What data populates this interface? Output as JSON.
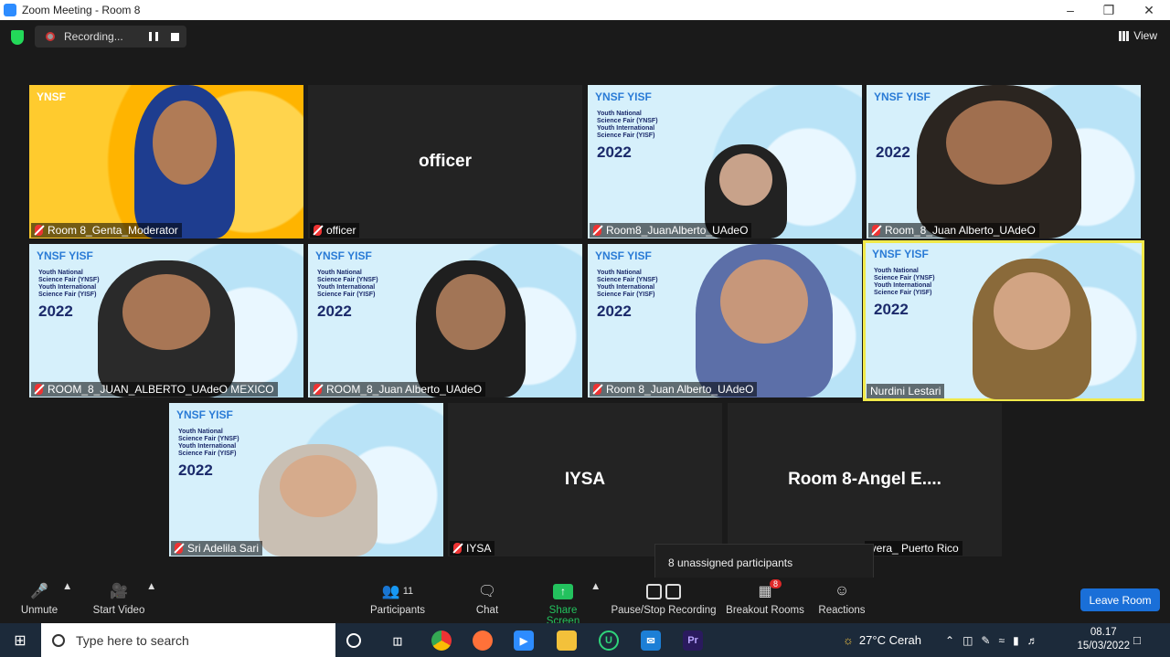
{
  "window": {
    "title": "Zoom Meeting - Room 8"
  },
  "recording": {
    "label": "Recording..."
  },
  "view_label": "View",
  "tiles": [
    {
      "name": "Room 8_Genta_Moderator",
      "big": ""
    },
    {
      "name": "officer",
      "big": "officer"
    },
    {
      "name": "Room8_JuanAlberto_UAdeO",
      "big": ""
    },
    {
      "name": "Room_8_Juan Alberto_UAdeO",
      "big": ""
    },
    {
      "name": "ROOM_8_JUAN_ALBERTO_UAdeO MEXICO",
      "big": ""
    },
    {
      "name": "ROOM_8_Juan Alberto_UAdeO",
      "big": ""
    },
    {
      "name": "Room 8_Juan Alberto_UAdeO",
      "big": ""
    },
    {
      "name": "Nurdini Lestari",
      "big": ""
    },
    {
      "name": "Sri Adelila Sari",
      "big": ""
    },
    {
      "name": "IYSA",
      "big": "IYSA"
    },
    {
      "name": "ivera_ Puerto Rico",
      "big": "Room 8-Angel E...."
    }
  ],
  "poster": {
    "logo": "YNSF YISF",
    "lines": [
      "Youth National",
      "Science Fair (YNSF)",
      "Youth International",
      "Science Fair (YISF)"
    ],
    "year": "2022"
  },
  "popup": {
    "text": "8 unassigned participants"
  },
  "toolbar": {
    "unmute": "Unmute",
    "start_video": "Start Video",
    "participants": "Participants",
    "participants_count": "11",
    "chat": "Chat",
    "share_screen": "Share Screen",
    "pause_stop": "Pause/Stop Recording",
    "breakout": "Breakout Rooms",
    "breakout_badge": "8",
    "reactions": "Reactions",
    "leave": "Leave Room"
  },
  "taskbar": {
    "search_placeholder": "Type here to search",
    "weather": "27°C  Cerah",
    "time": "08.17",
    "date": "15/03/2022"
  },
  "colors": {
    "accent_green": "#23c25e",
    "leave_blue": "#1a6fd8",
    "active_border": "#f1e94a"
  }
}
